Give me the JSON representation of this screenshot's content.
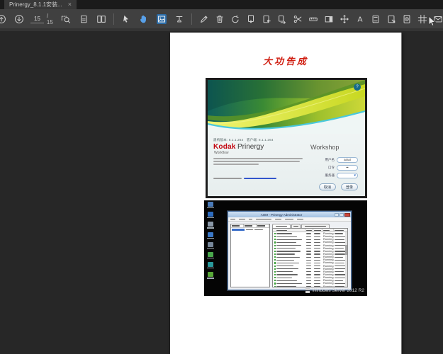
{
  "tab_bar": {
    "active_tab": "Prinergy_8.1.1安装...",
    "close_glyph": "×"
  },
  "toolbar": {
    "page_current": "15",
    "page_total": "/ 15",
    "groups": {
      "nav_a": [
        "page-up-icon",
        "page-down-icon"
      ],
      "nav_b": [
        "marquee-zoom-icon",
        "page-thumbnails-icon",
        "two-page-view-icon"
      ],
      "tools": [
        "select-tool-icon",
        "hand-tool-icon",
        "snapshot-tool-icon",
        "tool-dropdown-icon"
      ],
      "edit": [
        "edit-page-icon",
        "delete-page-icon",
        "rotate-page-icon",
        "extract-page-icon",
        "insert-page-icon",
        "replace-page-icon",
        "split-document-icon",
        "crop-ruler-icon",
        "artbox-icon",
        "move-tool-icon",
        "add-text-icon",
        "header-footer-icon",
        "watermark-icon",
        "redact-page-icon",
        "crop-grid-icon",
        "mail-icon"
      ]
    }
  },
  "document": {
    "heading": "大功告成",
    "heading_color": "#d01f12",
    "prinergy_dialog": {
      "help_glyph": "?",
      "version_line": "建构版本: 8.1.1.264　客户端: 8.1.1.264",
      "brand": {
        "kodak": "Kodak",
        "product": "Prinergy",
        "sub": "Workflow",
        "right": "Workshop"
      },
      "fields": [
        {
          "label": "用户名",
          "value": "araxi"
        },
        {
          "label": "口令",
          "value": "••"
        },
        {
          "label": "服务器",
          "value": ""
        }
      ],
      "dropdown_glyph": "▾",
      "buttons": {
        "cancel": "取消",
        "login": "登录"
      }
    },
    "windows_screenshot": {
      "window_title": "AOM - Prinergy Administrator",
      "desktop_icon_colors": [
        "#4a7ab8",
        "#2d6cc0",
        "#8a98a8",
        "#3a78c8",
        "#77879a",
        "#4aa84c",
        "#2a9a9c",
        "#58a838"
      ],
      "process_rows": [
        {
          "status": "Running"
        },
        {
          "status": "Running"
        },
        {
          "status": "Running"
        },
        {
          "status": "Running"
        },
        {
          "status": "Running"
        },
        {
          "status": "Running"
        },
        {
          "status": "Running"
        },
        {
          "status": "Running"
        },
        {
          "status": "Running"
        },
        {
          "status": "Running"
        },
        {
          "status": "Running"
        },
        {
          "status": "Running"
        },
        {
          "status": "Running"
        },
        {
          "status": "Running"
        },
        {
          "status": "Running"
        },
        {
          "status": "Running"
        },
        {
          "status": "Running"
        },
        {
          "status": "Running"
        },
        {
          "status": "Running"
        }
      ],
      "watermark": "Windows Server 2012 R2"
    }
  }
}
